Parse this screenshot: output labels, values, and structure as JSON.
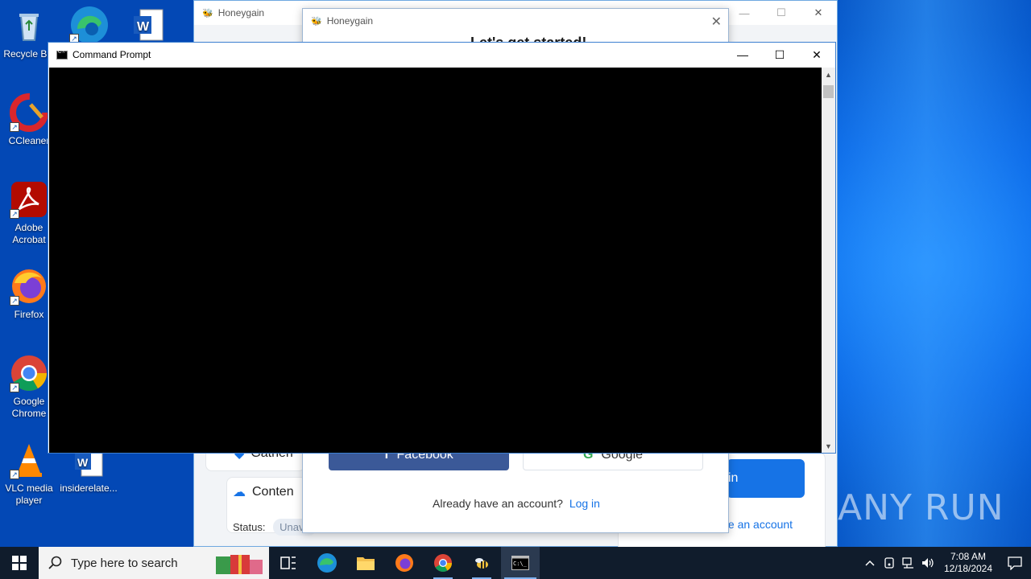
{
  "desktop": {
    "icons": [
      {
        "label": "Recycle Bin",
        "icon": "recycle-bin-icon"
      },
      {
        "label": "CCleaner",
        "icon": "ccleaner-icon"
      },
      {
        "label": "Adobe Acrobat",
        "icon": "adobe-acrobat-icon"
      },
      {
        "label": "Firefox",
        "icon": "firefox-icon"
      },
      {
        "label": "Google Chrome",
        "icon": "google-chrome-icon"
      },
      {
        "label": "VLC media player",
        "icon": "vlc-icon"
      },
      {
        "label": "insiderelate...",
        "icon": "word-document-icon"
      }
    ]
  },
  "honeygain_back": {
    "title": "Honeygain",
    "row1": "Gathen",
    "row2": "Conten",
    "status_label": "Status:",
    "status_value": "Unava",
    "login_button": "in",
    "create_account": "te an account"
  },
  "honeygain_front": {
    "title": "Honeygain",
    "heading": "Let's get started!",
    "facebook_button": "Facebook",
    "google_button": "Google",
    "already_text": "Already have an account?",
    "login_link": "Log in"
  },
  "cmd": {
    "title": "Command Prompt"
  },
  "watermark": "ANY RUN",
  "taskbar": {
    "search_placeholder": "Type here to search",
    "time": "7:08 AM",
    "date": "12/18/2024"
  },
  "colors": {
    "desktop_blue": "#0a5fd6",
    "taskbar": "#101c2c",
    "honeygain_blue": "#1673e6",
    "facebook_blue": "#3b5998"
  }
}
